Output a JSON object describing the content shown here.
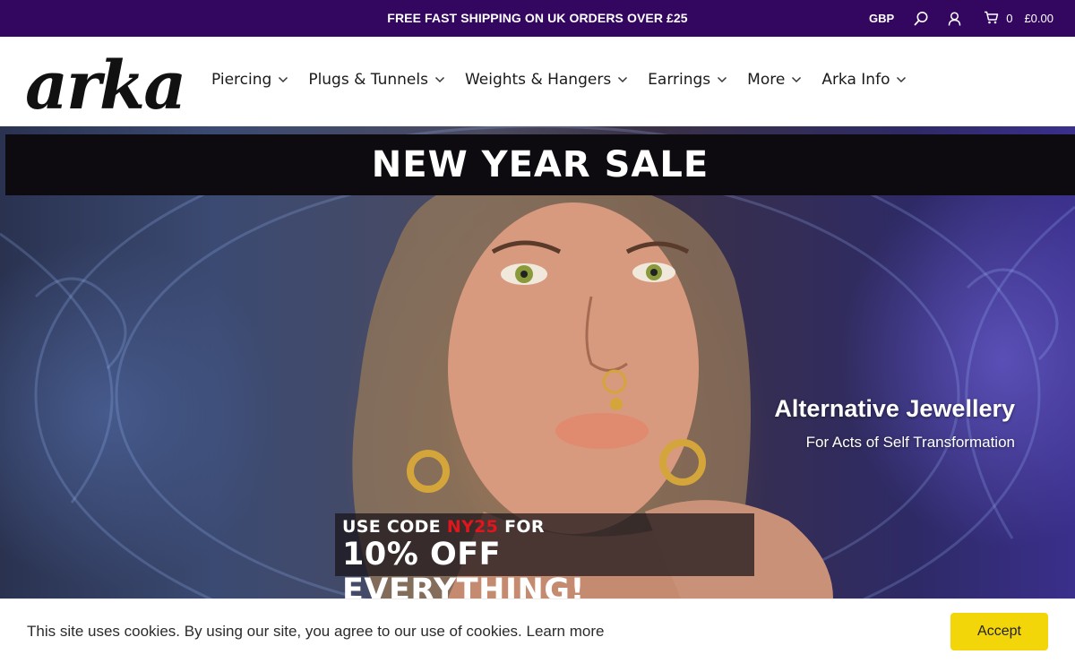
{
  "topbar": {
    "promo": "FREE FAST SHIPPING ON UK ORDERS OVER £25",
    "currency": "GBP",
    "cart_count": "0",
    "cart_total": "£0.00",
    "background": "#33065f"
  },
  "header": {
    "logo_text": "arka",
    "nav": [
      {
        "label": "Piercing"
      },
      {
        "label": "Plugs & Tunnels"
      },
      {
        "label": "Weights & Hangers"
      },
      {
        "label": "Earrings"
      },
      {
        "label": "More"
      },
      {
        "label": "Arka Info"
      }
    ]
  },
  "hero": {
    "sale_title": "NEW YEAR SALE",
    "tagline_title": "Alternative Jewellery",
    "tagline_subtitle": "For Acts of Self Transformation",
    "code_prefix": "USE CODE ",
    "code": "NY25",
    "code_suffix": " FOR",
    "offer": "10% OFF EVERYTHING!",
    "code_color": "#e1161c"
  },
  "cookie": {
    "message": "This site uses cookies. By using our site, you agree to our use of cookies.",
    "learn_more": "Learn more",
    "accept_label": "Accept",
    "accept_color": "#f2d60a"
  },
  "icons": [
    "search-icon",
    "account-icon",
    "cart-icon",
    "chevron-down-icon"
  ]
}
